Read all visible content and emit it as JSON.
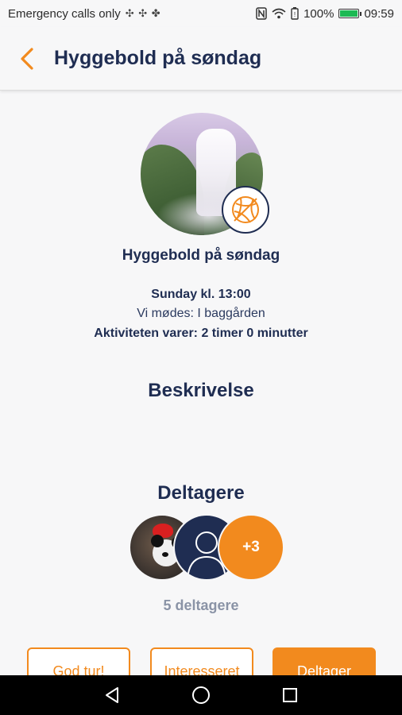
{
  "status_bar": {
    "carrier_text": "Emergency calls only",
    "battery_percent": "100%",
    "time": "09:59"
  },
  "app_bar": {
    "back_icon": "chevron-left-icon",
    "title": "Hyggebold på søndag"
  },
  "event": {
    "image_icon": "event-photo",
    "sport_icon": "volleyball-icon",
    "name": "Hyggebold på søndag",
    "time": "Sunday kl. 13:00",
    "location": "Vi mødes: I baggården",
    "duration": "Aktiviteten varer: 2 timer 0 minutter"
  },
  "description": {
    "heading": "Beskrivelse"
  },
  "participants": {
    "heading": "Deltagere",
    "more_count": "+3",
    "count_label": "5 deltagere"
  },
  "actions": {
    "good_trip": "God tur!",
    "interested": "Interesseret",
    "participating": "Deltager"
  },
  "colors": {
    "accent": "#f28a1e",
    "navy": "#1f2d52",
    "muted": "#8a93a6"
  },
  "nav_bar": {
    "back_icon": "triangle-back-icon",
    "home_icon": "circle-home-icon",
    "recents_icon": "square-recents-icon"
  }
}
